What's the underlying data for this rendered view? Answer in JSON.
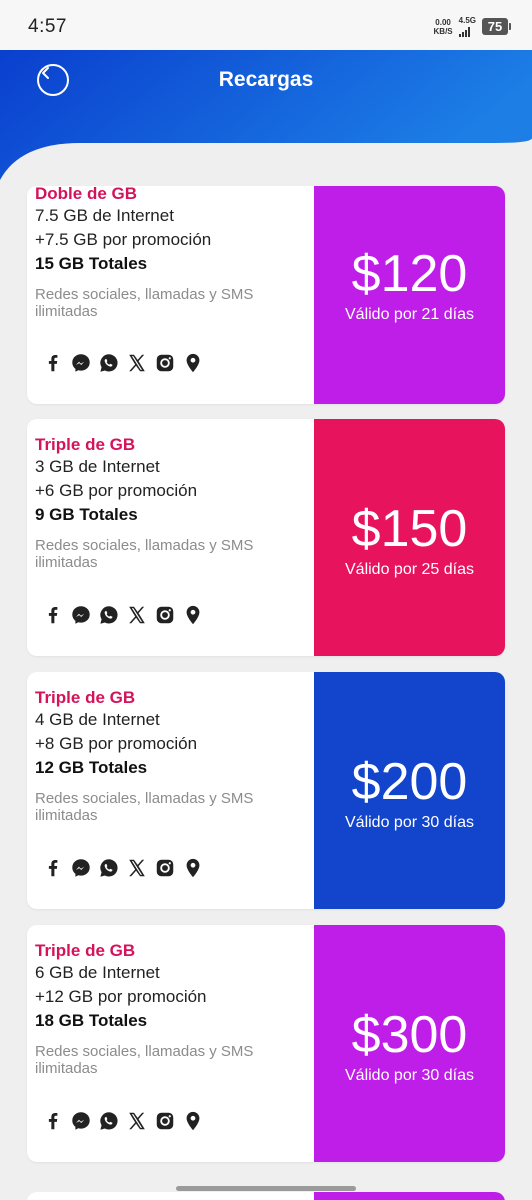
{
  "status_bar": {
    "time": "4:57",
    "net_speed_value": "0.00",
    "net_speed_unit": "KB/S",
    "network_type": "4.5G",
    "battery": "75"
  },
  "header": {
    "title": "Recargas",
    "back_icon": "chevron-left-icon",
    "gradient_colors": [
      "#0a3fce",
      "#1d7fe6"
    ]
  },
  "social_icons": [
    "facebook-icon",
    "messenger-icon",
    "whatsapp-icon",
    "x-icon",
    "instagram-icon",
    "location-pin-icon"
  ],
  "plans": [
    {
      "title": "Doble de GB",
      "internet": "7.5 GB de Internet",
      "promo": "+7.5 GB por promoción",
      "total": "15 GB Totales",
      "perks": "Redes sociales, llamadas y SMS ilimitadas",
      "price": "$120",
      "validity": "Válido por 21 días",
      "color": "#bf1ee8"
    },
    {
      "title": "Triple de GB",
      "internet": "3 GB de Internet",
      "promo": "+6 GB por promoción",
      "total": "9 GB Totales",
      "perks": "Redes sociales, llamadas y SMS ilimitadas",
      "price": "$150",
      "validity": "Válido por 25 días",
      "color": "#e8135d"
    },
    {
      "title": "Triple de GB",
      "internet": "4 GB de Internet",
      "promo": "+8 GB por promoción",
      "total": "12 GB Totales",
      "perks": "Redes sociales, llamadas y SMS ilimitadas",
      "price": "$200",
      "validity": "Válido por 30 días",
      "color": "#1244cc"
    },
    {
      "title": "Triple de GB",
      "internet": "6 GB de Internet",
      "promo": "+12 GB por promoción",
      "total": "18 GB Totales",
      "perks": "Redes sociales, llamadas y SMS ilimitadas",
      "price": "$300",
      "validity": "Válido por 30 días",
      "color": "#bf1ee8"
    }
  ]
}
